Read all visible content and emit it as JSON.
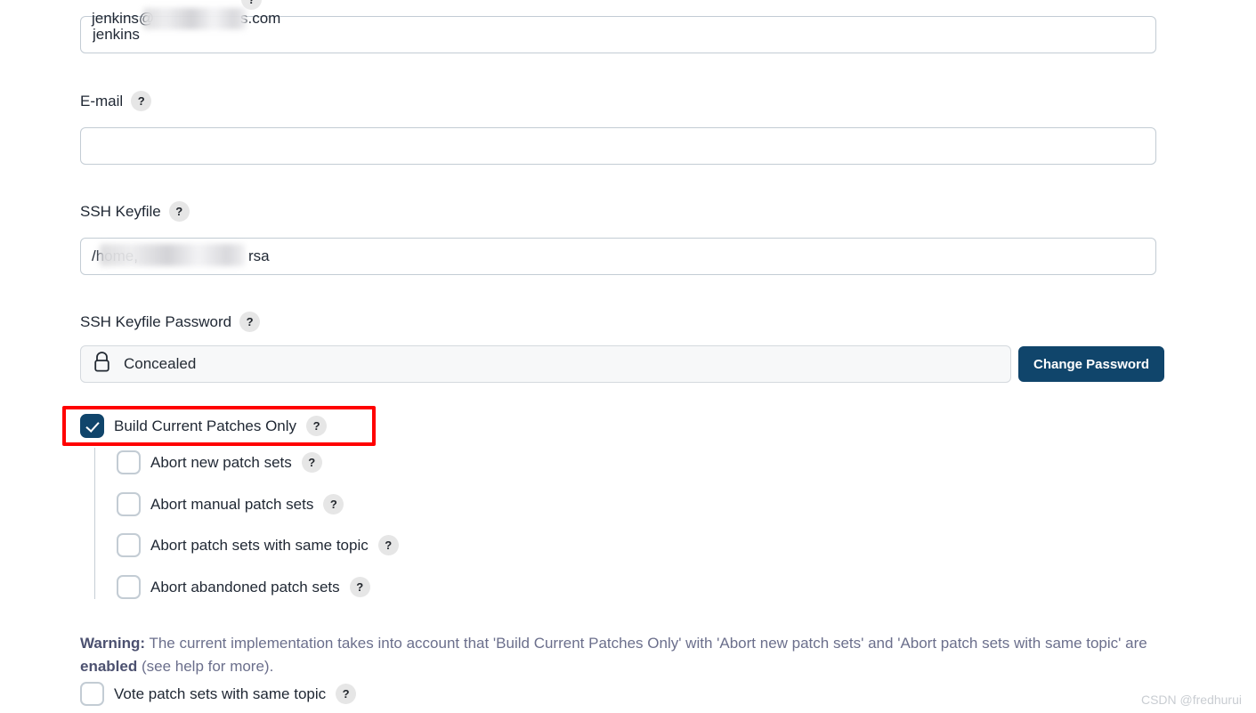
{
  "form": {
    "username": {
      "label_help_icon": "help-icon",
      "value": "jenkins"
    },
    "email": {
      "label": "E-mail",
      "help_icon": "help-icon",
      "value_prefix": "jenkins@",
      "value_suffix": "s.com",
      "redacted": true
    },
    "ssh_keyfile": {
      "label": "SSH Keyfile",
      "help_icon": "help-icon",
      "value_prefix": "/home,",
      "value_suffix": "rsa",
      "redacted": true
    },
    "ssh_keyfile_password": {
      "label": "SSH Keyfile Password",
      "help_icon": "help-icon",
      "status_text": "Concealed",
      "lock_icon": "lock-icon",
      "change_button_label": "Change Password"
    }
  },
  "options": {
    "build_current_patches_only": {
      "label": "Build Current Patches Only",
      "checked": true,
      "help_icon": "help-icon",
      "highlighted": true
    },
    "nested": [
      {
        "label": "Abort new patch sets",
        "checked": false,
        "help_icon": "help-icon"
      },
      {
        "label": "Abort manual patch sets",
        "checked": false,
        "help_icon": "help-icon"
      },
      {
        "label": "Abort patch sets with same topic",
        "checked": false,
        "help_icon": "help-icon"
      },
      {
        "label": "Abort abandoned patch sets",
        "checked": false,
        "help_icon": "help-icon"
      }
    ],
    "vote_patch_sets_same_topic": {
      "label": "Vote patch sets with same topic",
      "checked": false,
      "help_icon": "help-icon"
    }
  },
  "warning": {
    "prefix": "Warning:",
    "text_1": " The current implementation takes into account that 'Build Current Patches Only' with 'Abort new patch sets' and 'Abort patch sets with same topic' are ",
    "emphasis": "enabled",
    "text_2": " (see help for more)."
  },
  "watermark": {
    "text": "CSDN @fredhurui"
  },
  "colors": {
    "accent": "#10456b",
    "highlight": "#ff0000",
    "warning_text": "#6b6f8c",
    "border": "#c3ccd4"
  }
}
